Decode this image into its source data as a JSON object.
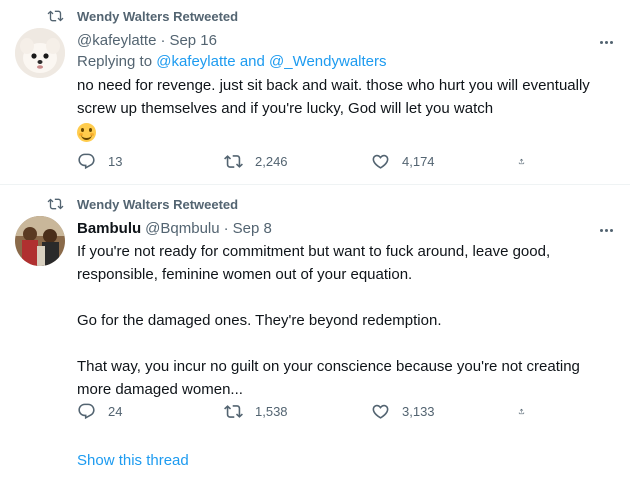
{
  "tweets": [
    {
      "retweeted_by": "Wendy Walters Retweeted",
      "handle": "@kafeylatte",
      "date": "Sep 16",
      "replying_prefix": "Replying to ",
      "replying_to": "@kafeylatte and @_Wendywalters",
      "text": "no need for revenge. just sit back and wait. those who hurt you will eventually screw up themselves and if you're lucky, God will let you watch",
      "emoji": "smiling-face-emoji",
      "stats": {
        "replies": "13",
        "retweets": "2,246",
        "likes": "4,174"
      }
    },
    {
      "retweeted_by": "Wendy Walters Retweeted",
      "name": "Bambulu",
      "handle": "@Bqmbulu",
      "date": "Sep 8",
      "text": "If you're not ready for commitment but want to fuck around, leave good, responsible, feminine women out of your equation.\n\nGo for the damaged ones. They're beyond redemption.\n\nThat way, you incur no guilt on your conscience because you're not creating more damaged women...",
      "stats": {
        "replies": "24",
        "retweets": "1,538",
        "likes": "3,133"
      },
      "show_thread": "Show this thread"
    }
  ],
  "colors": {
    "accent": "#1d9bf0",
    "secondary": "#536471",
    "text": "#0f1419"
  }
}
